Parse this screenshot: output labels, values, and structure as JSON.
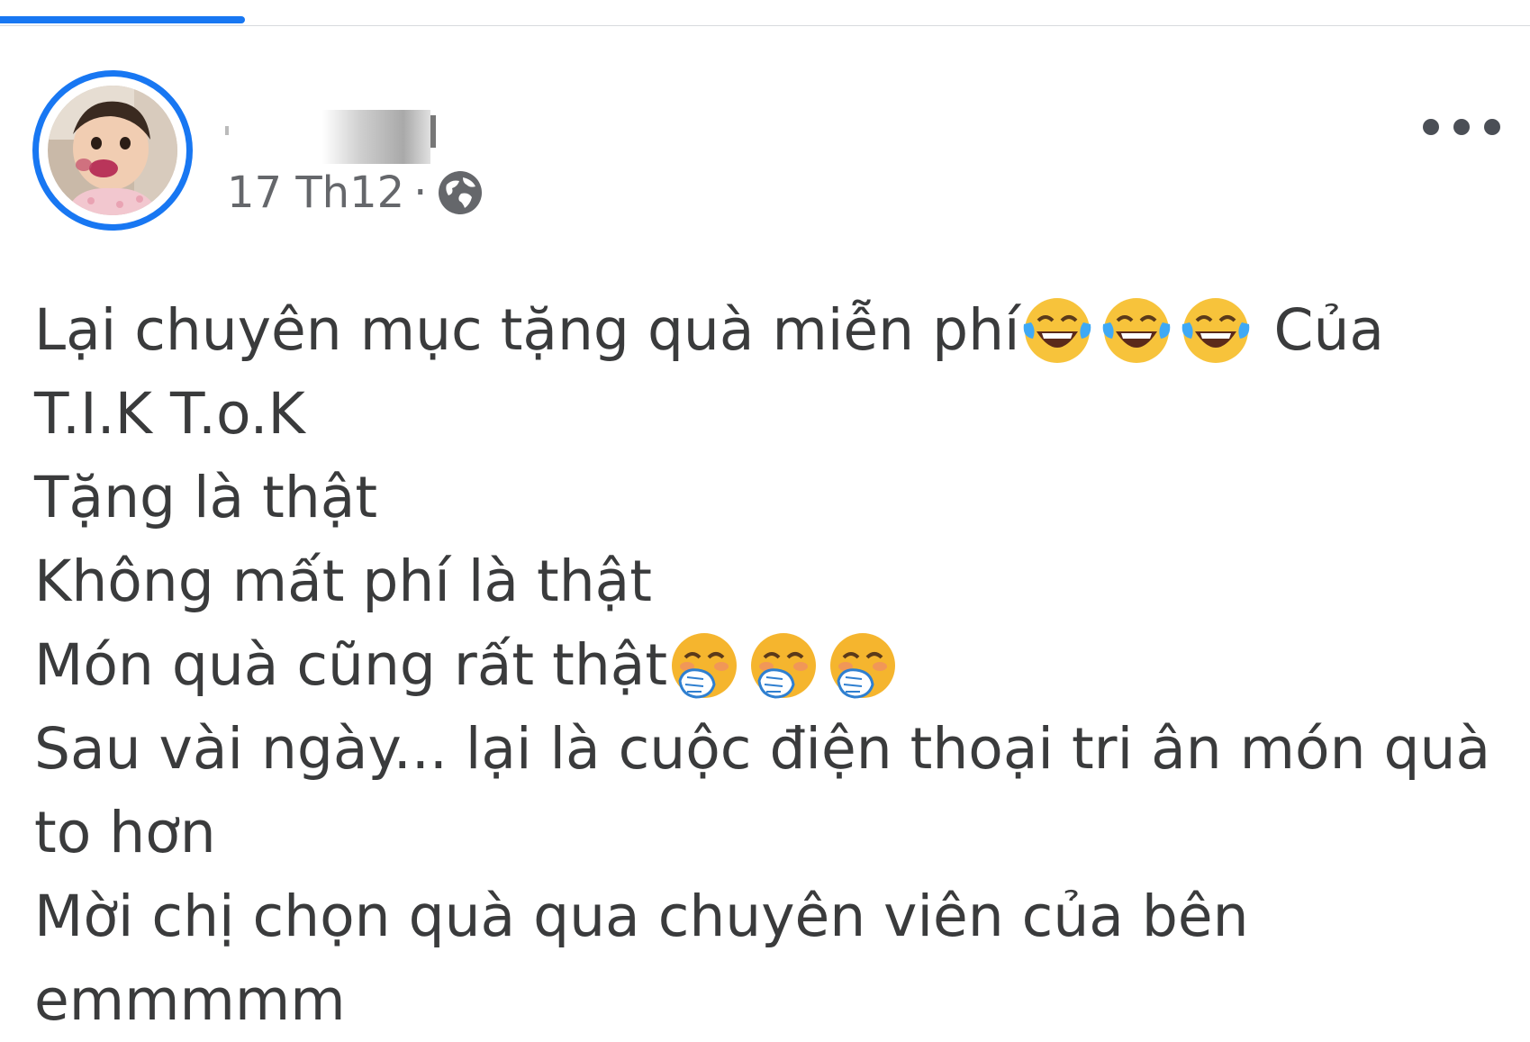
{
  "post": {
    "timestamp": "17 Th12",
    "separator": "·",
    "privacy_icon": "globe-icon",
    "more_icon": "more-options-icon",
    "avatar": "baby-photo",
    "lines": {
      "l1_text": "Lại chuyên mục tặng quà miễn phí",
      "l1_emoji": "face-with-tears-of-joy",
      "l1_tail": "Của",
      "l2": "T.I.K T.o.K",
      "l3": "Tặng là thật",
      "l4": "Không mất phí là thật",
      "l5_text": "Món quà cũng rất thật",
      "l5_emoji": "face-with-hand-over-mouth",
      "l6": "Sau vài ngày... lại là cuộc điện thoại tri ân món quà",
      "l7": "to hơn",
      "l8": "Mời chị chọn quà qua chuyên viên của bên",
      "l9": "emmmmm"
    }
  },
  "colors": {
    "accent": "#1877f2",
    "text": "#3a3b3c",
    "meta": "#65676b"
  }
}
